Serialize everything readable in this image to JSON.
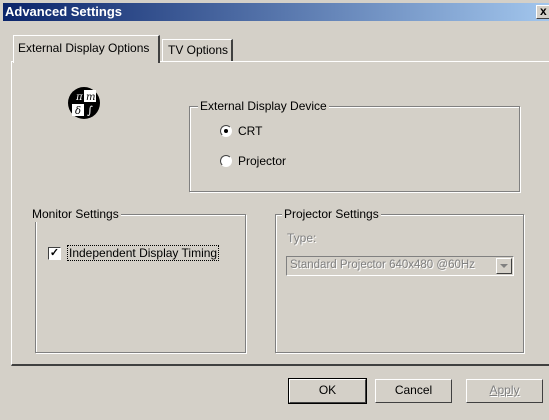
{
  "window": {
    "title": "Advanced Settings",
    "close_label": "x"
  },
  "tabs": [
    {
      "label": "External Display Options",
      "active": true
    },
    {
      "label": "TV Options",
      "active": false
    }
  ],
  "logo": {
    "glyphs": [
      "π",
      "m",
      "δ",
      "∫"
    ]
  },
  "external_display_device": {
    "legend": "External Display Device",
    "options": [
      {
        "label": "CRT",
        "selected": true
      },
      {
        "label": "Projector",
        "selected": false
      }
    ]
  },
  "monitor_settings": {
    "legend": "Monitor Settings",
    "independent_timing_label": "Independent Display Timing",
    "independent_timing_checked": true
  },
  "projector_settings": {
    "legend": "Projector Settings",
    "type_label": "Type:",
    "type_value": "Standard Projector 640x480 @60Hz",
    "enabled": false
  },
  "buttons": {
    "ok": "OK",
    "cancel": "Cancel",
    "apply": "Apply"
  }
}
